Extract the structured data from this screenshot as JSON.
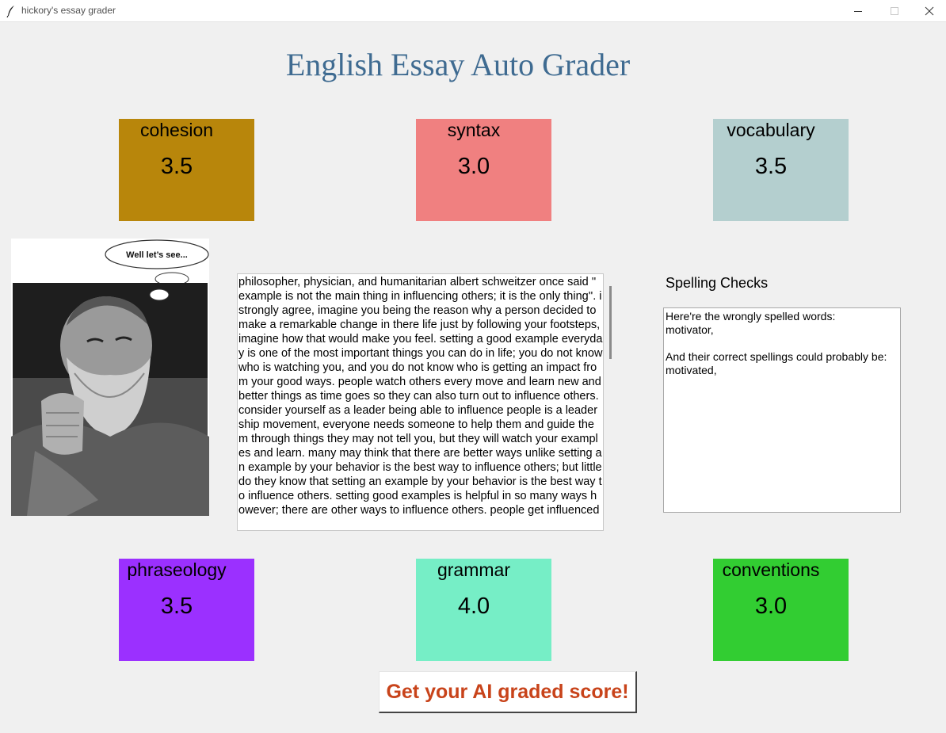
{
  "window": {
    "title": "hickory's essay grader",
    "app_icon": "feather-icon",
    "controls": [
      "minimize-icon",
      "maximize-icon",
      "close-icon"
    ]
  },
  "heading": "English Essay Auto Grader",
  "scores": {
    "cohesion": {
      "label": "cohesion",
      "value": "3.5",
      "color": "#b8860b"
    },
    "syntax": {
      "label": "syntax",
      "value": "3.0",
      "color": "#f08080"
    },
    "vocabulary": {
      "label": "vocabulary",
      "value": "3.5",
      "color": "#b4cfcf"
    },
    "phraseology": {
      "label": "phraseology",
      "value": "3.5",
      "color": "#9b30ff"
    },
    "grammar": {
      "label": "grammar",
      "value": "4.0",
      "color": "#76eec6"
    },
    "conventions": {
      "label": "conventions",
      "value": "3.0",
      "color": "#32cd32"
    }
  },
  "image": {
    "speech_bubble": "Well let’s see...",
    "description_icon": "thinking-man-photo"
  },
  "essay": {
    "text": "philosopher, physician, and humanitarian albert schweitzer once said '' example is not the main thing in influencing others; it is the only thing''. i strongly agree, imagine you being the reason why a person decided to make a remarkable change in there life just by following your footsteps, imagine how that would make you feel. setting a good example everyday is one of the most important things you can do in life; you do not know who is watching you, and you do not know who is getting an impact from your good ways. people watch others every move and learn new and better things as time goes so they can also turn out to influence others. consider yourself as a leader being able to influence people is a leadership movement, everyone needs someone to help them and guide them through things they may not tell you, but they will watch your examples and learn. many may think that there are better ways unlike setting an example by your behavior is the best way to influence others; but little do they know that setting an example by your behavior is the best way to influence others. setting good examples is helpful in so many ways however; there are other ways to influence others. people get influenced"
  },
  "spelling": {
    "label": "Spelling Checks",
    "text": "Here're the wrongly spelled words:\nmotivator,\n\nAnd their correct spellings could probably be:\nmotivated,"
  },
  "button": {
    "label": "Get your AI graded score!",
    "text_color": "#c8431a"
  }
}
